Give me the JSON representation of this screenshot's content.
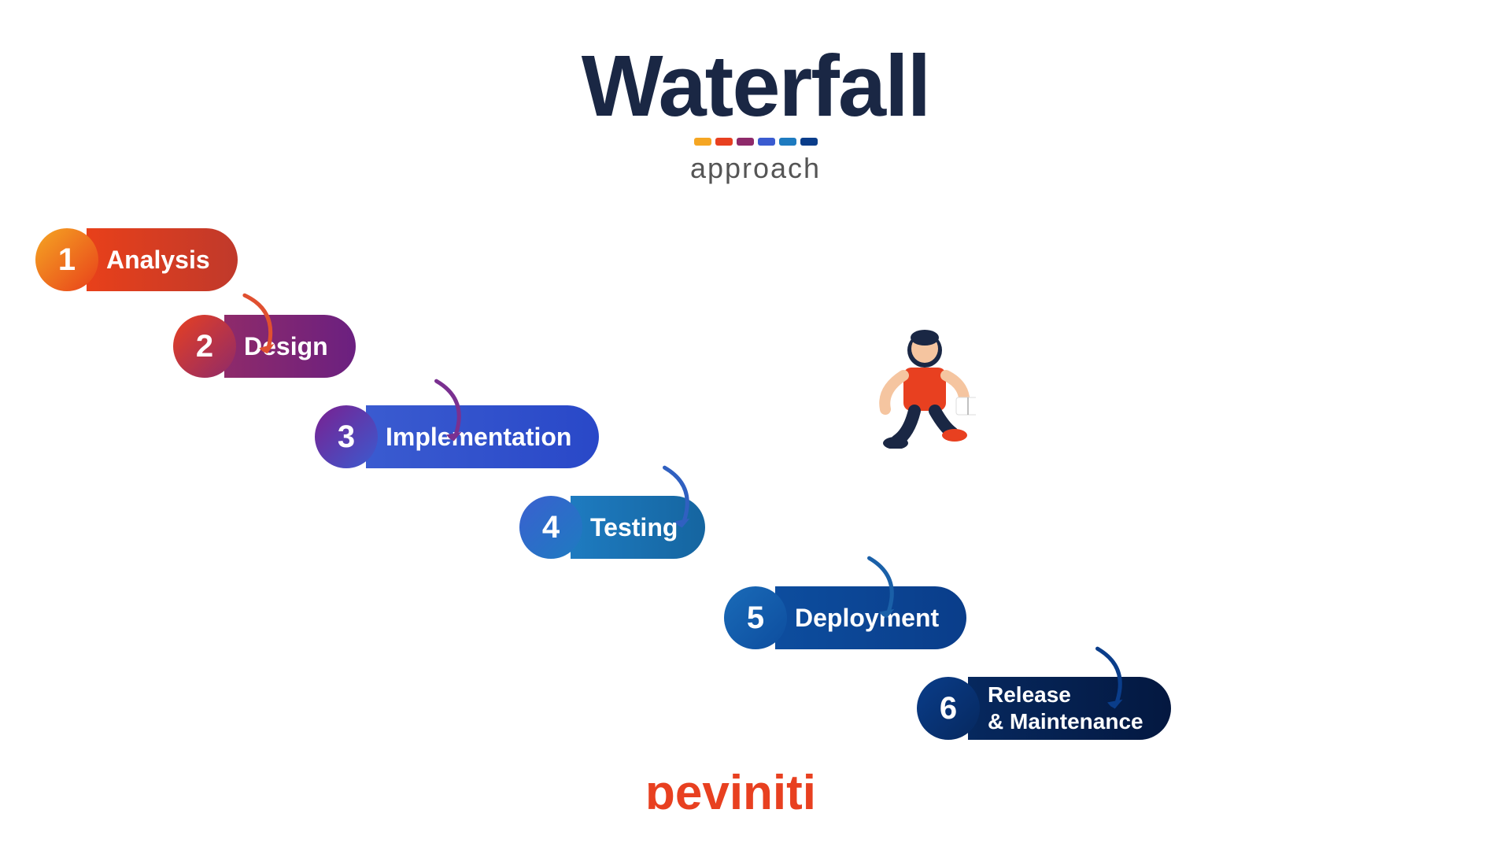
{
  "title": {
    "line1": "Waterfall",
    "line2": "approach",
    "decorations": [
      {
        "color": "#f5a623"
      },
      {
        "color": "#e84020"
      },
      {
        "color": "#8e2a6a"
      },
      {
        "color": "#3a5bd0"
      },
      {
        "color": "#1e7bc0"
      },
      {
        "color": "#0a3d8a"
      }
    ]
  },
  "steps": [
    {
      "number": "1",
      "label": "Analysis"
    },
    {
      "number": "2",
      "label": "Design"
    },
    {
      "number": "3",
      "label": "Implementation"
    },
    {
      "number": "4",
      "label": "Testing"
    },
    {
      "number": "5",
      "label": "Deployment"
    },
    {
      "number": "6",
      "label": "Release\n& Maintenance"
    }
  ],
  "brand": {
    "text": "ɔeviniti"
  }
}
